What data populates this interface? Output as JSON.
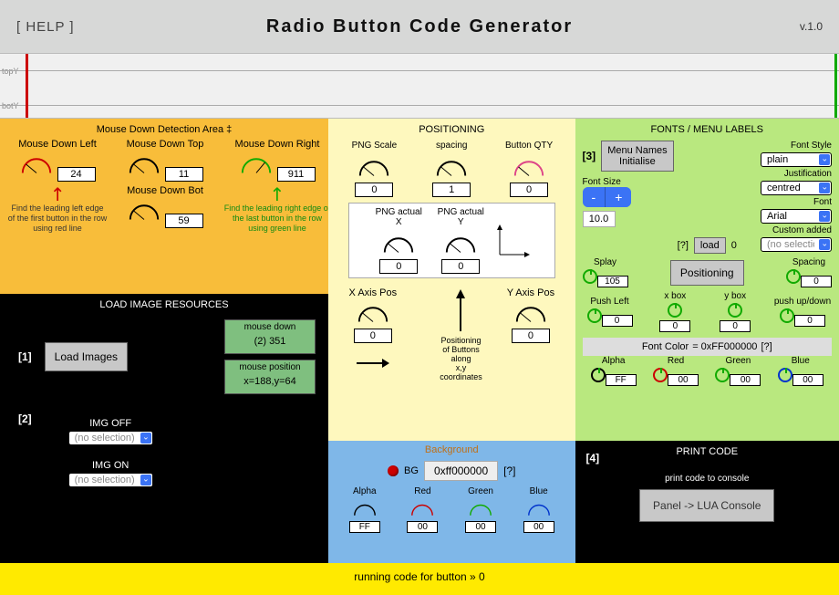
{
  "header": {
    "help": "[ HELP ]",
    "title": "Radio Button Code Generator",
    "version": "v.1.0"
  },
  "ruler": {
    "topLabel": "topY",
    "botLabel": "botY"
  },
  "orange": {
    "title": "Mouse Down Detection Area ‡",
    "left": {
      "label": "Mouse Down Left",
      "value": "24"
    },
    "top": {
      "label": "Mouse Down Top",
      "value": "11"
    },
    "right": {
      "label": "Mouse Down Right",
      "value": "911"
    },
    "bot": {
      "label": "Mouse Down Bot",
      "value": "59"
    },
    "hintLeft": "Find the leading left edge of the first button in the row using red line",
    "hintRight": "Find the leading right edge of the last button in the row using green line"
  },
  "black": {
    "title": "LOAD IMAGE RESOURCES",
    "idx1": "[1]",
    "idx2": "[2]",
    "loadBtn": "Load Images",
    "md": {
      "label": "mouse down",
      "value": "(2) 351"
    },
    "mp": {
      "label": "mouse position",
      "value": "x=188,y=64"
    },
    "imgOff": {
      "label": "IMG OFF",
      "value": "(no selection)"
    },
    "imgOn": {
      "label": "IMG ON",
      "value": "(no selection)"
    }
  },
  "yellow": {
    "title": "POSITIONING",
    "scale": {
      "label": "PNG Scale",
      "value": "0"
    },
    "spacing": {
      "label": "spacing",
      "value": "1"
    },
    "qty": {
      "label": "Button QTY",
      "value": "0"
    },
    "actX": {
      "label": "PNG actual X",
      "value": "0"
    },
    "actY": {
      "label": "PNG actual Y",
      "value": "0"
    },
    "xpos": {
      "label": "X Axis Pos",
      "value": "0"
    },
    "ypos": {
      "label": "Y Axis Pos",
      "value": "0"
    },
    "posText": "Positioning\nof Buttons along\nx,y coordinates"
  },
  "blue": {
    "title": "Background",
    "bgLabel": "BG",
    "hex": "0xff000000",
    "q": "[?]",
    "alpha": {
      "label": "Alpha",
      "value": "FF"
    },
    "red": {
      "label": "Red",
      "value": "00"
    },
    "green": {
      "label": "Green",
      "value": "00"
    },
    "blueC": {
      "label": "Blue",
      "value": "00"
    }
  },
  "green": {
    "title": "FONTS / MENU LABELS",
    "idx3": "[3]",
    "menuBtn": "Menu Names\nInitialise",
    "fontSizeLabel": "Font Size",
    "fontSize": "10.0",
    "minus": "-",
    "plus": "+",
    "q": "[?]",
    "loadBtn": "load",
    "loadVal": "0",
    "splay": {
      "label": "Splay",
      "value": "105"
    },
    "spacing": {
      "label": "Spacing",
      "value": "0"
    },
    "posBtn": "Positioning",
    "pushLeft": {
      "label": "Push Left",
      "value": "0"
    },
    "xbox": {
      "label": "x box",
      "value": "0"
    },
    "ybox": {
      "label": "y box",
      "value": "0"
    },
    "pushUD": {
      "label": "push up/down",
      "value": "0"
    },
    "style": {
      "label": "Font Style",
      "value": "plain"
    },
    "justif": {
      "label": "Justification",
      "value": "centred"
    },
    "font": {
      "label": "Font",
      "value": "Arial"
    },
    "custom": {
      "label": "Custom added",
      "value": "(no selection)"
    },
    "colorLabel": "Font Color",
    "colorEq": "= 0xFF000000",
    "colorQ": "[?]",
    "alpha": {
      "label": "Alpha",
      "value": "FF"
    },
    "red": {
      "label": "Red",
      "value": "00"
    },
    "greenC": {
      "label": "Green",
      "value": "00"
    },
    "blueC": {
      "label": "Blue",
      "value": "00"
    }
  },
  "print": {
    "title": "PRINT CODE",
    "idx4": "[4]",
    "sub": "print code to console",
    "btn": "Panel -> LUA Console"
  },
  "status": "running code for button »   0"
}
